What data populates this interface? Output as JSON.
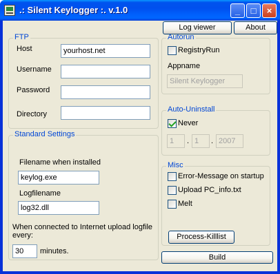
{
  "window": {
    "title": ".: Silent Keylogger :. v.1.0",
    "minimize_glyph": "_",
    "maximize_glyph": "□",
    "close_glyph": "×"
  },
  "toolbar": {
    "log_viewer_label": "Log viewer",
    "about_label": "About"
  },
  "ftp": {
    "title": "FTP",
    "host_label": "Host",
    "host_value": "yourhost.net",
    "username_label": "Username",
    "username_value": "",
    "password_label": "Password",
    "password_value": "",
    "directory_label": "Directory",
    "directory_value": ""
  },
  "standard": {
    "title": "Standard Settings",
    "filename_label": "Filename when installed",
    "filename_value": "keylog.exe",
    "logfilename_label": "Logfilename",
    "logfilename_value": "log32.dll",
    "upload_label": "When connected to Internet upload logfile every:",
    "interval_value": "30",
    "minutes_label": "minutes."
  },
  "autorun": {
    "title": "Autorun",
    "registry_label": "RegistryRun",
    "registry_checked": false,
    "appname_label": "Appname",
    "appname_value": "Silent Keylogger"
  },
  "uninstall": {
    "title": "Auto-Uninstall",
    "never_label": "Never",
    "never_checked": true,
    "day_value": "1",
    "month_value": "1",
    "year_value": "2007",
    "separator": "."
  },
  "misc": {
    "title": "Misc",
    "error_label": "Error-Message on startup",
    "upload_pcinfo_label": "Upload PC_info.txt",
    "melt_label": "Melt",
    "killlist_label": "Process-Killlist"
  },
  "build_label": "Build",
  "colors": {
    "titlebar": "#0054e3",
    "group_title": "#0046d5",
    "window_bg": "#ece9d8",
    "check_mark": "#21a121"
  }
}
